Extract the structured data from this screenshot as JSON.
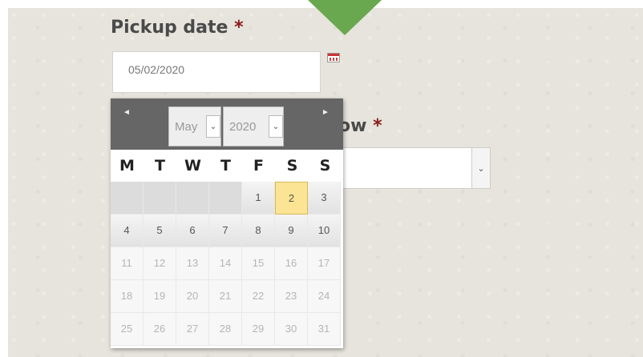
{
  "form": {
    "pickup_label": "Pickup date",
    "required_mark": "*",
    "pickup_value": "05/02/2020",
    "second_label_partial": "ow",
    "select_arrow": "⌄"
  },
  "datepicker": {
    "prev": "◄",
    "next": "►",
    "month": "May",
    "year": "2020",
    "dropdown_arrow": "⌄",
    "weekdays": [
      "M",
      "T",
      "W",
      "T",
      "F",
      "S",
      "S"
    ],
    "rows": [
      [
        "",
        "",
        "",
        "",
        "1",
        "2",
        "3"
      ],
      [
        "4",
        "5",
        "6",
        "7",
        "8",
        "9",
        "10"
      ],
      [
        "11",
        "12",
        "13",
        "14",
        "15",
        "16",
        "17"
      ],
      [
        "18",
        "19",
        "20",
        "21",
        "22",
        "23",
        "24"
      ],
      [
        "25",
        "26",
        "27",
        "28",
        "29",
        "30",
        "31"
      ]
    ],
    "selected_day": "2",
    "colors": {
      "header": "#666666",
      "selected": "#fbe493"
    }
  },
  "decor": {
    "arrow_color": "#6aa84f"
  }
}
